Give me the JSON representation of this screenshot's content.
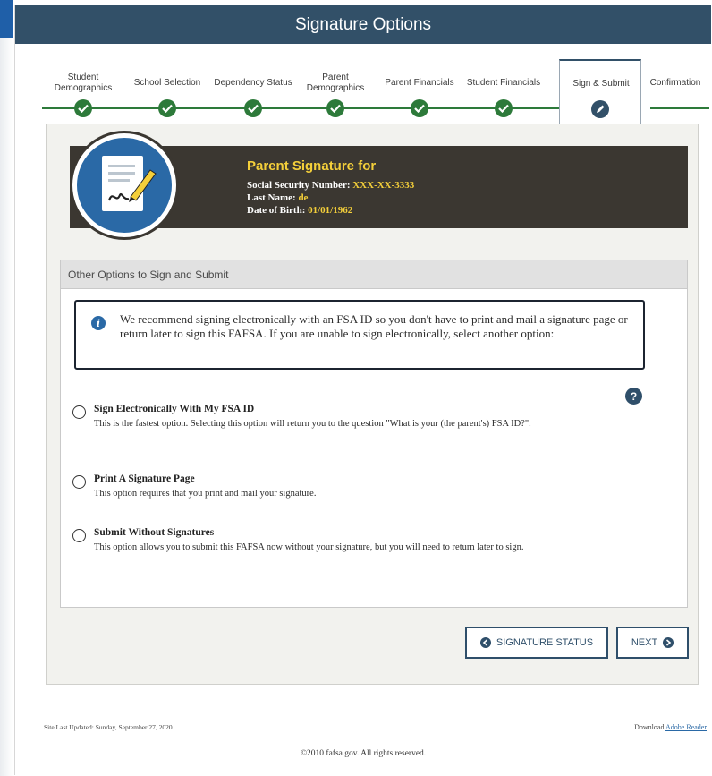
{
  "header": {
    "title": "Signature Options"
  },
  "steps": [
    {
      "label": "Student Demographics",
      "status": "complete"
    },
    {
      "label": "School Selection",
      "status": "complete"
    },
    {
      "label": "Dependency Status",
      "status": "complete"
    },
    {
      "label": "Parent Demographics",
      "status": "complete"
    },
    {
      "label": "Parent Financials",
      "status": "complete"
    },
    {
      "label": "Student Financials",
      "status": "complete"
    },
    {
      "label": "Sign & Submit",
      "status": "current"
    },
    {
      "label": "Confirmation",
      "status": "upcoming"
    }
  ],
  "signature": {
    "title": "Parent Signature for",
    "ssn_label": "Social Security Number:",
    "ssn_value": "XXX-XX-3333",
    "last_name_label": "Last Name:",
    "last_name_value": "de",
    "dob_label": "Date of Birth:",
    "dob_value": "01/01/1962"
  },
  "options_section": {
    "header": "Other Options to Sign and Submit",
    "info": "We recommend signing electronically with an FSA ID so you don't have to print and mail a signature page or return later to sign this FAFSA. If you are unable to sign electronically, select another option:",
    "help_icon": "?",
    "options": [
      {
        "title": "Sign Electronically With My FSA ID",
        "description": "This is the fastest option. Selecting this option will return you to the question \"What is your (the parent's) FSA ID?\".",
        "selected": false
      },
      {
        "title": "Print A Signature Page",
        "description": "This option requires that you print and mail your signature.",
        "selected": false
      },
      {
        "title": "Submit Without Signatures",
        "description": "This option allows you to submit this FAFSA now without your signature, but you will need to return later to sign.",
        "selected": false
      }
    ]
  },
  "buttons": {
    "signature_status": "SIGNATURE STATUS",
    "next": "NEXT"
  },
  "footer": {
    "updated": "Site Last Updated: Sunday, September 27, 2020",
    "download_label": "Download",
    "download_link": "Adobe Reader",
    "copyright": "©2010 fafsa.gov. All rights reserved."
  },
  "colors": {
    "title_bar": "#325068",
    "complete_green": "#2d7a3a",
    "accent_yellow": "#f4cf3a",
    "badge_blue": "#2a69a6"
  },
  "icons": [
    "check-icon",
    "pencil-icon",
    "signature-document-icon",
    "info-icon",
    "help-icon",
    "arrow-left-icon",
    "arrow-right-icon"
  ]
}
